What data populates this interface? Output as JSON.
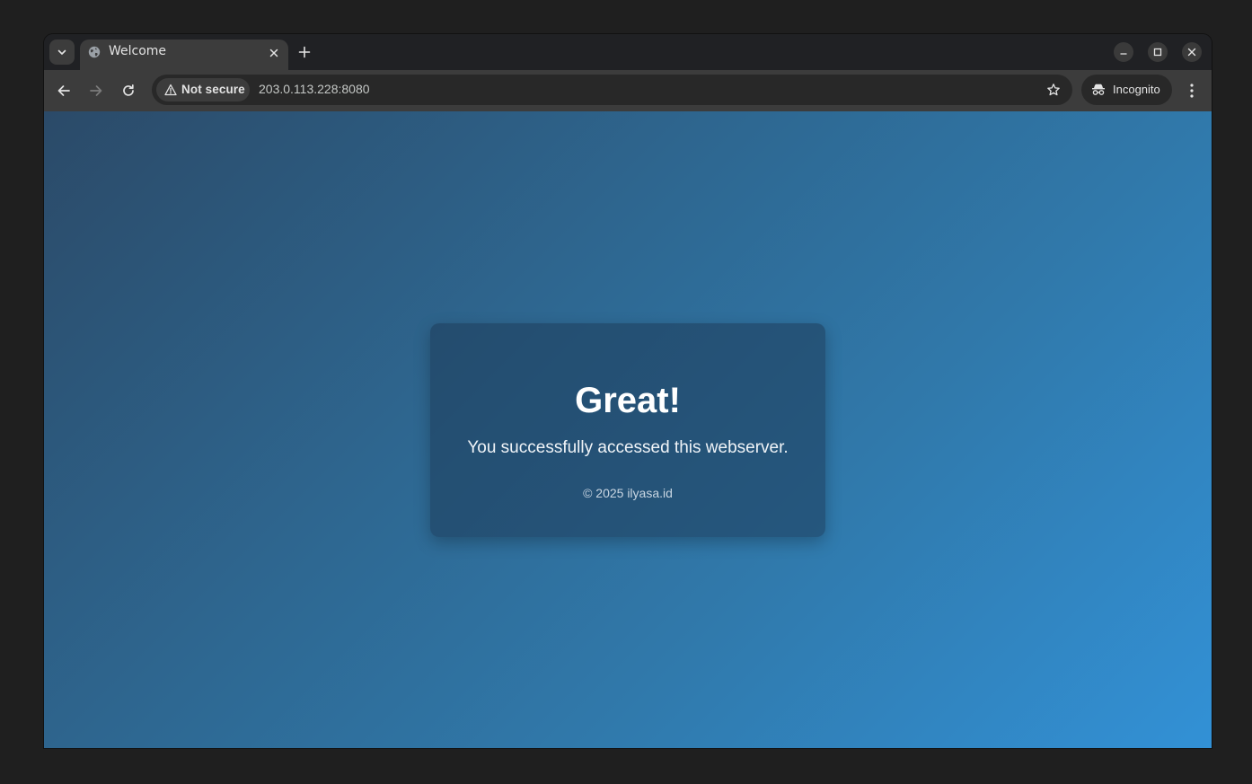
{
  "browser": {
    "tab": {
      "title": "Welcome"
    },
    "address": {
      "security_label": "Not secure",
      "url": "203.0.113.228:8080"
    },
    "profile_label": "Incognito"
  },
  "page": {
    "heading": "Great!",
    "message": "You successfully accessed this webserver.",
    "footer": "© 2025 ilyasa.id"
  },
  "colors": {
    "gradient_start": "#2b4a68",
    "gradient_end": "#3291d6",
    "card_bg": "#1e3a58"
  },
  "icons": [
    "tab-search-icon",
    "globe-icon",
    "close-icon",
    "plus-icon",
    "minimize-icon",
    "maximize-icon",
    "window-close-icon",
    "back-arrow-icon",
    "forward-arrow-icon",
    "reload-icon",
    "warning-icon",
    "star-icon",
    "incognito-icon",
    "kebab-menu-icon"
  ]
}
